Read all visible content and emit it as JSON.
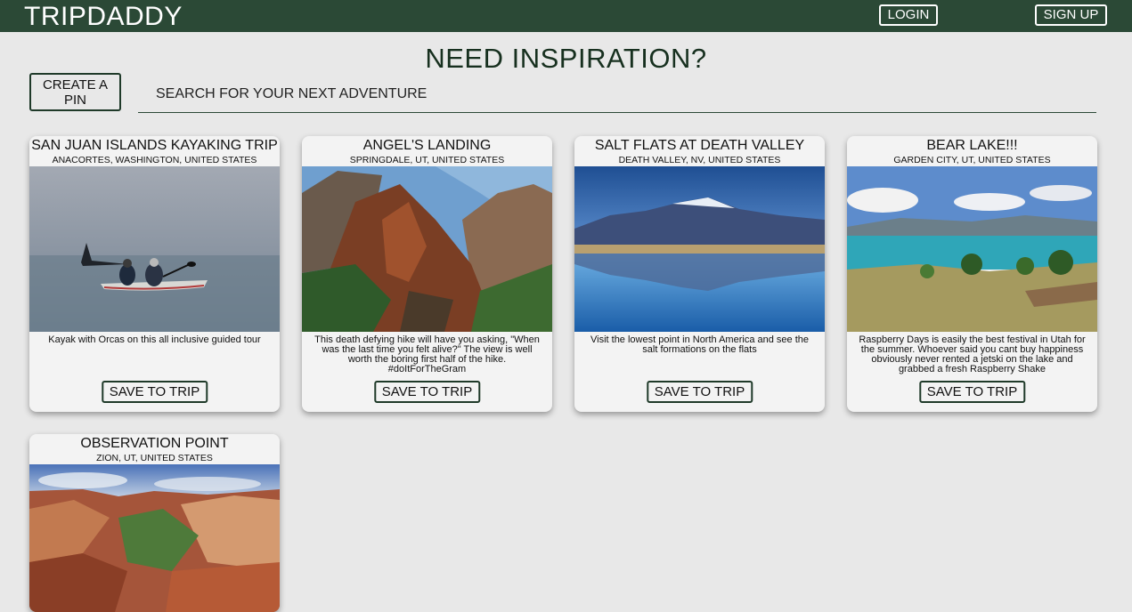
{
  "header": {
    "brand": "TRIPDADDY",
    "login_label": "LOGIN",
    "signup_label": "SIGN UP"
  },
  "main": {
    "title": "NEED INSPIRATION?",
    "create_pin_label": "CREATE A PIN",
    "search_placeholder": "SEARCH FOR YOUR NEXT ADVENTURE"
  },
  "cards": [
    {
      "title": "SAN JUAN ISLANDS KAYAKING TRIP",
      "location": "ANACORTES, WASHINGTON, UNITED STATES",
      "description": "Kayak with Orcas on this all inclusive guided tour",
      "save_label": "SAVE TO TRIP",
      "image": "kayakers-with-orca-photo"
    },
    {
      "title": "ANGEL'S LANDING",
      "location": "SPRINGDALE, UT, UNITED STATES",
      "description": "This death defying hike will have you asking, \"When was the last time you felt alive?\" The view is well worth the boring first half of the hike. #doItForTheGram",
      "save_label": "SAVE TO TRIP",
      "image": "red-canyon-cliffs-photo"
    },
    {
      "title": "SALT FLATS AT DEATH VALLEY",
      "location": "DEATH VALLEY, NV, UNITED STATES",
      "description": "Visit the lowest point in North America and see the salt formations on the flats",
      "save_label": "SAVE TO TRIP",
      "image": "mountain-reflection-photo"
    },
    {
      "title": "BEAR LAKE!!!",
      "location": "GARDEN CITY, UT, UNITED STATES",
      "description": "Raspberry Days is easily the best festival in Utah for the summer. Whoever said you cant buy happiness obviously never rented a jetski on the lake and grabbed a fresh Raspberry Shake",
      "save_label": "SAVE TO TRIP",
      "image": "turquoise-lake-photo"
    },
    {
      "title": "OBSERVATION POINT",
      "location": "ZION, UT, UNITED STATES",
      "description": "",
      "save_label": "",
      "image": "zion-canyon-overlook-photo"
    }
  ]
}
